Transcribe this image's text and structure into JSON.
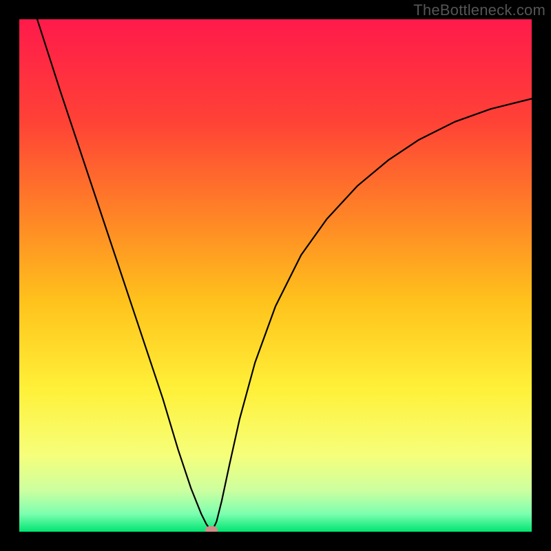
{
  "watermark": "TheBottleneck.com",
  "chart_data": {
    "type": "line",
    "title": "",
    "xlabel": "",
    "ylabel": "",
    "xlim": [
      0,
      1
    ],
    "ylim": [
      0,
      1
    ],
    "grid": false,
    "legend": false,
    "background_gradient": {
      "stops": [
        {
          "pos": 0.0,
          "color": "#ff1a4b"
        },
        {
          "pos": 0.2,
          "color": "#ff4236"
        },
        {
          "pos": 0.4,
          "color": "#ff8a25"
        },
        {
          "pos": 0.55,
          "color": "#ffc21c"
        },
        {
          "pos": 0.72,
          "color": "#fff038"
        },
        {
          "pos": 0.85,
          "color": "#f6ff7a"
        },
        {
          "pos": 0.92,
          "color": "#ccffa0"
        },
        {
          "pos": 0.965,
          "color": "#7dffb0"
        },
        {
          "pos": 1.0,
          "color": "#00e572"
        }
      ]
    },
    "series": [
      {
        "name": "bottleneck-curve",
        "stroke": "#000000",
        "stroke_width": 2.2,
        "x": [
          0.035,
          0.08,
          0.13,
          0.18,
          0.23,
          0.28,
          0.31,
          0.335,
          0.355,
          0.365,
          0.372,
          0.378,
          0.385,
          0.395,
          0.41,
          0.43,
          0.46,
          0.5,
          0.55,
          0.6,
          0.66,
          0.72,
          0.78,
          0.85,
          0.92,
          1.0
        ],
        "y": [
          1.0,
          0.86,
          0.71,
          0.56,
          0.41,
          0.26,
          0.16,
          0.085,
          0.035,
          0.015,
          0.005,
          0.005,
          0.02,
          0.06,
          0.13,
          0.22,
          0.33,
          0.44,
          0.54,
          0.61,
          0.675,
          0.725,
          0.765,
          0.8,
          0.825,
          0.845
        ]
      }
    ],
    "marker": {
      "x": 0.375,
      "y": 0.003,
      "color": "#cf8d87"
    }
  }
}
